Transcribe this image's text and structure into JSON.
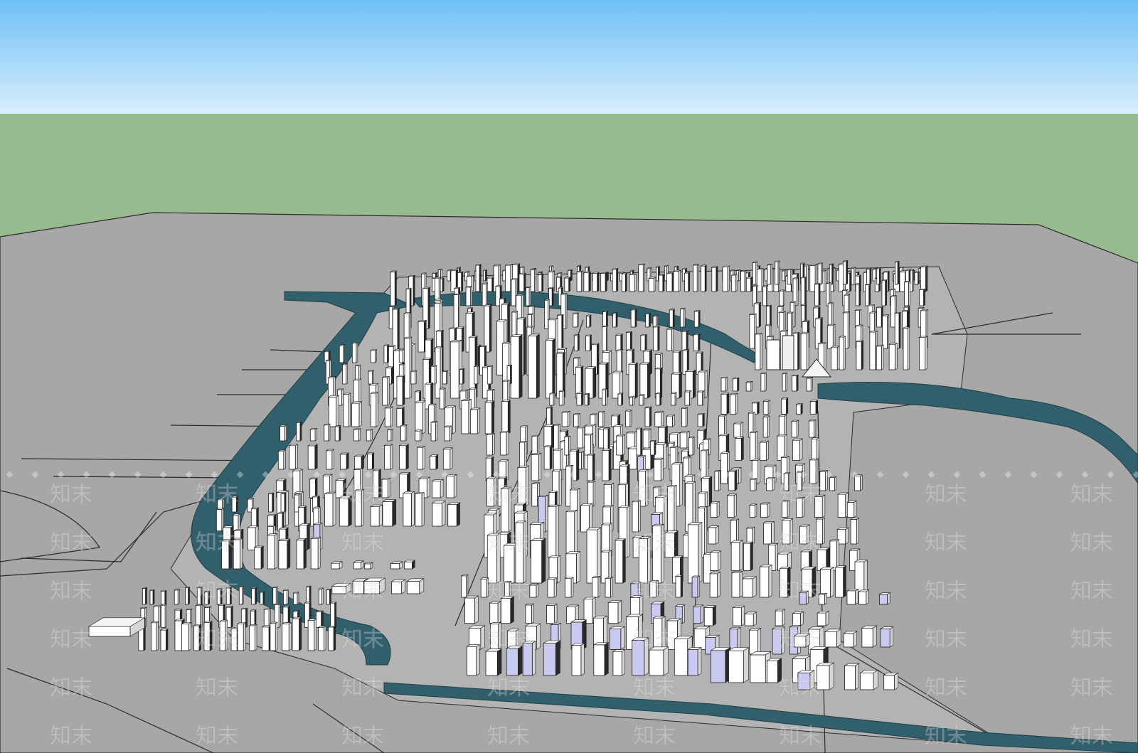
{
  "viewport": {
    "name": "3d-city-model-viewport",
    "sky_top_color": "#6fc0f6",
    "sky_bottom_color": "#d8eefc",
    "ground_color": "#97bb8e",
    "plane_color": "#a7a7a7",
    "water_color": "#315f6b",
    "building_color": "#ffffff",
    "building_dark_color": "#2a2a2a",
    "highlight_color": "#c9c9f1"
  },
  "watermark": {
    "text": "知末",
    "color": "#ffffff"
  }
}
